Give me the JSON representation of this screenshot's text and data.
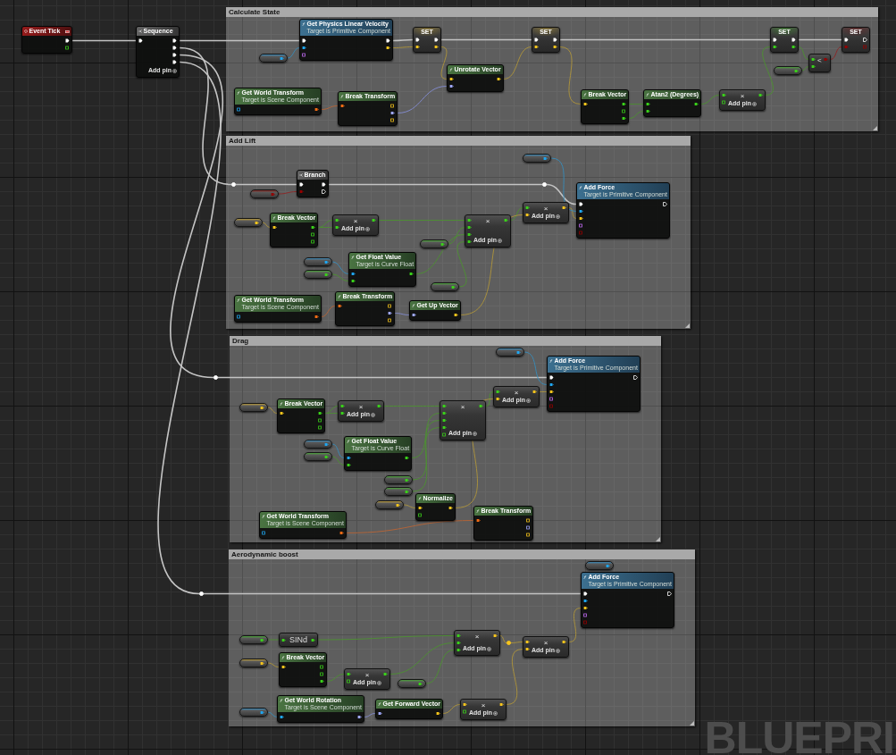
{
  "nodes": [
    {
      "kind": "event",
      "title": "Event Tick",
      "outputs": [
        {
          "kind": "exec",
          "linked": true
        },
        {
          "kind": "float",
          "linked": false
        }
      ]
    },
    {
      "kind": "flow",
      "title": "Sequence",
      "inputs": [
        {
          "kind": "exec",
          "linked": true
        }
      ],
      "outputs": [
        {
          "kind": "exec",
          "linked": true
        },
        {
          "kind": "exec",
          "linked": true
        },
        {
          "kind": "exec",
          "linked": true
        },
        {
          "kind": "exec",
          "linked": true
        }
      ],
      "add_pin": "Add pin"
    }
  ],
  "comments": [
    {
      "title": "Calculate State",
      "nodes": [
        {
          "kind": "impure",
          "title": "Get Physics Linear Velocity",
          "subtitle": "Target is Primitive Component",
          "inputs": [
            {
              "kind": "exec",
              "linked": true
            },
            {
              "kind": "object",
              "linked": true
            },
            {
              "kind": "name",
              "linked": false
            }
          ],
          "outputs": [
            {
              "kind": "exec",
              "linked": true
            },
            {
              "kind": "vector",
              "linked": true
            }
          ]
        },
        {
          "kind": "variable",
          "outputs": [
            {
              "kind": "object",
              "linked": true
            }
          ]
        },
        {
          "kind": "set",
          "title": "SET",
          "inputs": [
            {
              "kind": "exec",
              "linked": true
            },
            {
              "kind": "vector",
              "linked": true
            }
          ],
          "outputs": [
            {
              "kind": "exec",
              "linked": true
            },
            {
              "kind": "vector",
              "linked": true
            }
          ]
        },
        {
          "kind": "pure",
          "title": "Unrotate Vector",
          "inputs": [
            {
              "kind": "vector",
              "linked": true
            },
            {
              "kind": "rotator",
              "linked": true
            }
          ],
          "outputs": [
            {
              "kind": "vector",
              "linked": true
            }
          ]
        },
        {
          "kind": "pure",
          "title": "Get World Transform",
          "subtitle": "Target is Scene Component",
          "inputs": [
            {
              "kind": "object",
              "linked": false
            }
          ],
          "outputs": [
            {
              "kind": "transform",
              "linked": true
            }
          ]
        },
        {
          "kind": "pure",
          "title": "Break Transform",
          "inputs": [
            {
              "kind": "transform",
              "linked": true
            }
          ],
          "outputs": [
            {
              "kind": "vector",
              "linked": false
            },
            {
              "kind": "rotator",
              "linked": true
            },
            {
              "kind": "vector",
              "linked": false
            }
          ]
        },
        {
          "kind": "set",
          "title": "SET",
          "inputs": [
            {
              "kind": "exec",
              "linked": true
            },
            {
              "kind": "vector",
              "linked": true
            }
          ],
          "outputs": [
            {
              "kind": "exec",
              "linked": true
            },
            {
              "kind": "vector",
              "linked": true
            }
          ]
        },
        {
          "kind": "pure",
          "title": "Break Vector",
          "inputs": [
            {
              "kind": "vector",
              "linked": true
            }
          ],
          "outputs": [
            {
              "kind": "float",
              "linked": true
            },
            {
              "kind": "float",
              "linked": false
            },
            {
              "kind": "float",
              "linked": true
            }
          ]
        },
        {
          "kind": "pure",
          "title": "Atan2 (Degrees)",
          "inputs": [
            {
              "kind": "float",
              "linked": true
            },
            {
              "kind": "float",
              "linked": true
            }
          ],
          "outputs": [
            {
              "kind": "float",
              "linked": true
            }
          ]
        },
        {
          "kind": "math",
          "symbol": "×",
          "inputs": [
            {
              "kind": "float",
              "linked": true
            },
            {
              "kind": "float",
              "linked": false
            }
          ],
          "outputs": [
            {
              "kind": "float",
              "linked": true
            }
          ],
          "add_pin": "Add pin"
        },
        {
          "kind": "set",
          "title": "SET",
          "inputs": [
            {
              "kind": "exec",
              "linked": true
            },
            {
              "kind": "float",
              "linked": true
            }
          ],
          "outputs": [
            {
              "kind": "exec",
              "linked": true
            },
            {
              "kind": "float",
              "linked": true
            }
          ]
        },
        {
          "kind": "variable",
          "outputs": [
            {
              "kind": "float",
              "linked": true
            }
          ]
        },
        {
          "kind": "math",
          "symbol": "<",
          "inputs": [
            {
              "kind": "float",
              "linked": true
            },
            {
              "kind": "float",
              "linked": true
            }
          ],
          "outputs": [
            {
              "kind": "bool",
              "linked": true
            }
          ]
        },
        {
          "kind": "set",
          "title": "SET",
          "inputs": [
            {
              "kind": "exec",
              "linked": true
            },
            {
              "kind": "bool",
              "linked": true
            }
          ],
          "outputs": [
            {
              "kind": "exec",
              "linked": false
            },
            {
              "kind": "bool",
              "linked": false
            }
          ]
        }
      ]
    },
    {
      "title": "Add Lift",
      "nodes": [
        {
          "kind": "reroute",
          "inputs": [
            {
              "kind": "exec",
              "linked": true
            }
          ]
        },
        {
          "kind": "flow",
          "title": "Branch",
          "inputs": [
            {
              "kind": "exec",
              "linked": true
            },
            {
              "kind": "bool",
              "linked": true
            }
          ],
          "outputs": [
            {
              "kind": "exec",
              "linked": true
            },
            {
              "kind": "exec",
              "linked": false
            }
          ]
        },
        {
          "kind": "variable",
          "outputs": [
            {
              "kind": "bool",
              "linked": true
            }
          ]
        },
        {
          "kind": "reroute",
          "inputs": [
            {
              "kind": "exec",
              "linked": true
            }
          ]
        },
        {
          "kind": "variable",
          "outputs": [
            {
              "kind": "vector",
              "linked": true
            }
          ]
        },
        {
          "kind": "pure",
          "title": "Break Vector",
          "inputs": [
            {
              "kind": "vector",
              "linked": true
            }
          ],
          "outputs": [
            {
              "kind": "float",
              "linked": true
            },
            {
              "kind": "float",
              "linked": false
            },
            {
              "kind": "float",
              "linked": false
            }
          ]
        },
        {
          "kind": "math",
          "symbol": "×",
          "inputs": [
            {
              "kind": "float",
              "linked": true
            },
            {
              "kind": "float",
              "linked": true
            }
          ],
          "outputs": [
            {
              "kind": "float",
              "linked": true
            }
          ],
          "add_pin": "Add pin"
        },
        {
          "kind": "math",
          "symbol": "×",
          "inputs": [
            {
              "kind": "float",
              "linked": true
            },
            {
              "kind": "float",
              "linked": true
            },
            {
              "kind": "float",
              "linked": true
            },
            {
              "kind": "float",
              "linked": true
            }
          ],
          "outputs": [
            {
              "kind": "float",
              "linked": true
            }
          ],
          "add_pin": "Add pin"
        },
        {
          "kind": "variable",
          "outputs": [
            {
              "kind": "float",
              "linked": true
            }
          ]
        },
        {
          "kind": "variable",
          "outputs": [
            {
              "kind": "object",
              "linked": true
            }
          ]
        },
        {
          "kind": "variable",
          "outputs": [
            {
              "kind": "float",
              "linked": true
            }
          ]
        },
        {
          "kind": "pure",
          "title": "Get Float Value",
          "subtitle": "Target is Curve Float",
          "inputs": [
            {
              "kind": "object",
              "linked": true
            },
            {
              "kind": "float",
              "linked": true
            }
          ],
          "outputs": [
            {
              "kind": "float",
              "linked": true
            }
          ]
        },
        {
          "kind": "variable",
          "outputs": [
            {
              "kind": "float",
              "linked": true
            }
          ]
        },
        {
          "kind": "pure",
          "title": "Get World Transform",
          "subtitle": "Target is Scene Component",
          "inputs": [
            {
              "kind": "object",
              "linked": false
            }
          ],
          "outputs": [
            {
              "kind": "transform",
              "linked": true
            }
          ]
        },
        {
          "kind": "pure",
          "title": "Break Transform",
          "inputs": [
            {
              "kind": "transform",
              "linked": true
            }
          ],
          "outputs": [
            {
              "kind": "vector",
              "linked": false
            },
            {
              "kind": "rotator",
              "linked": true
            },
            {
              "kind": "vector",
              "linked": false
            }
          ]
        },
        {
          "kind": "pure",
          "title": "Get Up Vector",
          "inputs": [
            {
              "kind": "rotator",
              "linked": true
            }
          ],
          "outputs": [
            {
              "kind": "vector",
              "linked": true
            }
          ]
        },
        {
          "kind": "math",
          "symbol": "×",
          "inputs": [
            {
              "kind": "float",
              "linked": true
            },
            {
              "kind": "vector",
              "linked": true
            }
          ],
          "outputs": [
            {
              "kind": "vector",
              "linked": true
            }
          ],
          "add_pin": "Add pin"
        },
        {
          "kind": "variable",
          "outputs": [
            {
              "kind": "object",
              "linked": true
            }
          ]
        },
        {
          "kind": "impure",
          "title": "Add Force",
          "subtitle": "Target is Primitive Component",
          "inputs": [
            {
              "kind": "exec",
              "linked": true
            },
            {
              "kind": "object",
              "linked": true
            },
            {
              "kind": "vector",
              "linked": true
            },
            {
              "kind": "name",
              "linked": false
            },
            {
              "kind": "bool",
              "linked": false
            }
          ],
          "outputs": [
            {
              "kind": "exec",
              "linked": false
            }
          ]
        }
      ]
    },
    {
      "title": "Drag",
      "nodes": [
        {
          "kind": "reroute",
          "inputs": [
            {
              "kind": "exec",
              "linked": true
            }
          ]
        },
        {
          "kind": "variable",
          "outputs": [
            {
              "kind": "object",
              "linked": true
            }
          ]
        },
        {
          "kind": "impure",
          "title": "Add Force",
          "subtitle": "Target is Primitive Component",
          "inputs": [
            {
              "kind": "exec",
              "linked": true
            },
            {
              "kind": "object",
              "linked": true
            },
            {
              "kind": "vector",
              "linked": true
            },
            {
              "kind": "name",
              "linked": false
            },
            {
              "kind": "bool",
              "linked": false
            }
          ],
          "outputs": [
            {
              "kind": "exec",
              "linked": false
            }
          ]
        },
        {
          "kind": "variable",
          "outputs": [
            {
              "kind": "vector",
              "linked": true
            }
          ]
        },
        {
          "kind": "pure",
          "title": "Break Vector",
          "inputs": [
            {
              "kind": "vector",
              "linked": true
            }
          ],
          "outputs": [
            {
              "kind": "float",
              "linked": true
            },
            {
              "kind": "float",
              "linked": false
            },
            {
              "kind": "float",
              "linked": false
            }
          ]
        },
        {
          "kind": "math",
          "symbol": "×",
          "inputs": [
            {
              "kind": "float",
              "linked": true
            },
            {
              "kind": "float",
              "linked": true
            }
          ],
          "outputs": [
            {
              "kind": "float",
              "linked": true
            }
          ],
          "add_pin": "Add pin"
        },
        {
          "kind": "math",
          "symbol": "×",
          "inputs": [
            {
              "kind": "float",
              "linked": true
            },
            {
              "kind": "float",
              "linked": true
            },
            {
              "kind": "float",
              "linked": true
            },
            {
              "kind": "float",
              "linked": true
            },
            {
              "kind": "float",
              "linked": false
            }
          ],
          "outputs": [
            {
              "kind": "float",
              "linked": true
            }
          ],
          "add_pin": "Add pin"
        },
        {
          "kind": "math",
          "symbol": "×",
          "inputs": [
            {
              "kind": "float",
              "linked": true
            },
            {
              "kind": "vector",
              "linked": true
            }
          ],
          "outputs": [
            {
              "kind": "vector",
              "linked": true
            }
          ],
          "add_pin": "Add pin"
        },
        {
          "kind": "variable",
          "outputs": [
            {
              "kind": "object",
              "linked": true
            }
          ]
        },
        {
          "kind": "variable",
          "outputs": [
            {
              "kind": "float",
              "linked": true
            }
          ]
        },
        {
          "kind": "pure",
          "title": "Get Float Value",
          "subtitle": "Target is Curve Float",
          "inputs": [
            {
              "kind": "object",
              "linked": true
            },
            {
              "kind": "float",
              "linked": true
            }
          ],
          "outputs": [
            {
              "kind": "float",
              "linked": true
            }
          ]
        },
        {
          "kind": "variable",
          "outputs": [
            {
              "kind": "float",
              "linked": true
            }
          ]
        },
        {
          "kind": "variable",
          "outputs": [
            {
              "kind": "float",
              "linked": true
            }
          ]
        },
        {
          "kind": "variable",
          "outputs": [
            {
              "kind": "vector",
              "linked": true
            }
          ]
        },
        {
          "kind": "pure",
          "title": "Normalize",
          "inputs": [
            {
              "kind": "vector",
              "linked": true
            },
            {
              "kind": "float",
              "linked": false
            }
          ],
          "outputs": [
            {
              "kind": "vector",
              "linked": true
            }
          ]
        },
        {
          "kind": "pure",
          "title": "Get World Transform",
          "subtitle": "Target is Scene Component",
          "inputs": [
            {
              "kind": "object",
              "linked": false
            }
          ],
          "outputs": [
            {
              "kind": "transform",
              "linked": true
            }
          ]
        },
        {
          "kind": "pure",
          "title": "Break Transform",
          "inputs": [
            {
              "kind": "transform",
              "linked": true
            }
          ],
          "outputs": [
            {
              "kind": "vector",
              "linked": false
            },
            {
              "kind": "rotator",
              "linked": false
            },
            {
              "kind": "vector",
              "linked": false
            }
          ]
        }
      ]
    },
    {
      "title": "Aerodynamic boost",
      "nodes": [
        {
          "kind": "reroute",
          "inputs": [
            {
              "kind": "exec",
              "linked": true
            }
          ]
        },
        {
          "kind": "variable",
          "outputs": [
            {
              "kind": "object",
              "linked": true
            }
          ]
        },
        {
          "kind": "impure",
          "title": "Add Force",
          "subtitle": "Target is Primitive Component",
          "inputs": [
            {
              "kind": "exec",
              "linked": true
            },
            {
              "kind": "object",
              "linked": true
            },
            {
              "kind": "vector",
              "linked": true
            },
            {
              "kind": "name",
              "linked": false
            },
            {
              "kind": "bool",
              "linked": false
            }
          ],
          "outputs": [
            {
              "kind": "exec",
              "linked": false
            }
          ]
        },
        {
          "kind": "variable",
          "outputs": [
            {
              "kind": "float",
              "linked": true
            }
          ]
        },
        {
          "kind": "compact",
          "title": "SINd",
          "inputs": [
            {
              "kind": "float",
              "linked": true
            }
          ],
          "outputs": [
            {
              "kind": "float",
              "linked": true
            }
          ]
        },
        {
          "kind": "variable",
          "outputs": [
            {
              "kind": "vector",
              "linked": true
            }
          ]
        },
        {
          "kind": "pure",
          "title": "Break Vector",
          "inputs": [
            {
              "kind": "vector",
              "linked": true
            }
          ],
          "outputs": [
            {
              "kind": "float",
              "linked": false
            },
            {
              "kind": "float",
              "linked": false
            },
            {
              "kind": "float",
              "linked": true
            }
          ]
        },
        {
          "kind": "math",
          "symbol": "×",
          "inputs": [
            {
              "kind": "float",
              "linked": true
            },
            {
              "kind": "float",
              "linked": false
            }
          ],
          "outputs": [
            {
              "kind": "float",
              "linked": true
            }
          ],
          "add_pin": "Add pin"
        },
        {
          "kind": "math",
          "symbol": "×",
          "inputs": [
            {
              "kind": "float",
              "linked": true
            },
            {
              "kind": "float",
              "linked": true
            },
            {
              "kind": "float",
              "linked": true
            }
          ],
          "outputs": [
            {
              "kind": "vector",
              "linked": true
            }
          ],
          "add_pin": "Add pin"
        },
        {
          "kind": "reroute",
          "inputs": [
            {
              "kind": "vector",
              "linked": true
            }
          ]
        },
        {
          "kind": "math",
          "symbol": "×",
          "inputs": [
            {
              "kind": "vector",
              "linked": true
            },
            {
              "kind": "vector",
              "linked": true
            }
          ],
          "outputs": [
            {
              "kind": "vector",
              "linked": true
            }
          ],
          "add_pin": "Add pin"
        },
        {
          "kind": "variable",
          "outputs": [
            {
              "kind": "float",
              "linked": true
            }
          ]
        },
        {
          "kind": "variable",
          "outputs": [
            {
              "kind": "object",
              "linked": true
            }
          ]
        },
        {
          "kind": "pure",
          "title": "Get World Rotation",
          "subtitle": "Target is Scene Component",
          "inputs": [
            {
              "kind": "object",
              "linked": true
            }
          ],
          "outputs": [
            {
              "kind": "rotator",
              "linked": true
            }
          ]
        },
        {
          "kind": "pure",
          "title": "Get Forward Vector",
          "inputs": [
            {
              "kind": "rotator",
              "linked": true
            }
          ],
          "outputs": [
            {
              "kind": "vector",
              "linked": true
            }
          ]
        },
        {
          "kind": "math",
          "symbol": "×",
          "inputs": [
            {
              "kind": "vector",
              "linked": true
            },
            {
              "kind": "float",
              "linked": false
            }
          ],
          "outputs": [
            {
              "kind": "vector",
              "linked": true
            }
          ],
          "add_pin": "Add pin"
        }
      ]
    }
  ],
  "graph_label": "BLUEPRI"
}
